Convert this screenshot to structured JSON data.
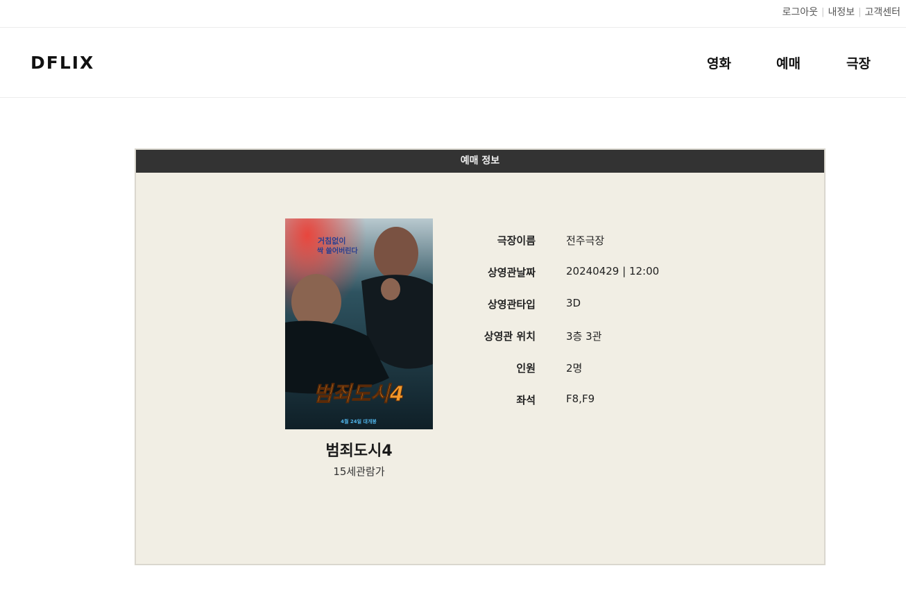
{
  "util": {
    "logout": "로그아웃",
    "myinfo": "내정보",
    "support": "고객센터"
  },
  "header": {
    "logo": "DFLIX",
    "nav": [
      {
        "label": "영화"
      },
      {
        "label": "예매"
      },
      {
        "label": "극장"
      }
    ]
  },
  "reservation": {
    "heading": "예매 정보",
    "movie": {
      "title": "범죄도시4",
      "rating": "15세관람가",
      "poster": {
        "tagline_line1": "거침없이",
        "tagline_line2": "싹 쓸어버린다",
        "title": "범죄도시4",
        "release": "4월 24일 대개봉"
      }
    },
    "details": [
      {
        "label": "극장이름",
        "value": "전주극장"
      },
      {
        "label": "상영관날짜",
        "value": "20240429 | 12:00"
      },
      {
        "label": "상영관타입",
        "value": "3D"
      },
      {
        "label": "상영관 위치",
        "value": "3층 3관"
      },
      {
        "label": "인원",
        "value": "2명"
      },
      {
        "label": "좌석",
        "value": "F8,F9"
      }
    ]
  }
}
